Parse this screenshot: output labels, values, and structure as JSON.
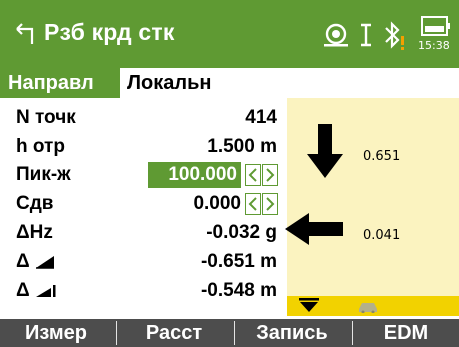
{
  "header": {
    "title": "Рзб крд стк",
    "clock": "15:38",
    "icons": [
      "back-icon",
      "target-icon",
      "cursor-icon",
      "bluetooth-warning-icon",
      "battery-icon"
    ]
  },
  "tabs": [
    {
      "label": "Направл",
      "active": true
    },
    {
      "label": "Локальн",
      "active": false
    }
  ],
  "fields": {
    "n_points": {
      "label": "N точк",
      "value": "414"
    },
    "h_refl": {
      "label": "h отр",
      "value": "1.500 m"
    },
    "picket": {
      "label": "Пик-ж",
      "value": "100.000"
    },
    "offset": {
      "label": "Сдв",
      "value": "0.000"
    },
    "dhz": {
      "label": "ΔHz",
      "value": "-0.032 g"
    },
    "d_slope": {
      "label": "Δ",
      "value": "-0.651 m"
    },
    "d_height": {
      "label": "Δ",
      "value": "-0.548 m"
    }
  },
  "graphic": {
    "down_value": "0.651",
    "left_value": "0.041"
  },
  "softkeys": [
    "Измер",
    "Расст",
    "Запись",
    "EDM"
  ],
  "colors": {
    "accent": "#5f9a33",
    "graphic_bg": "#fbf3c0",
    "bar_yellow": "#f2d200",
    "softkey_bg": "#4d4d4d"
  }
}
